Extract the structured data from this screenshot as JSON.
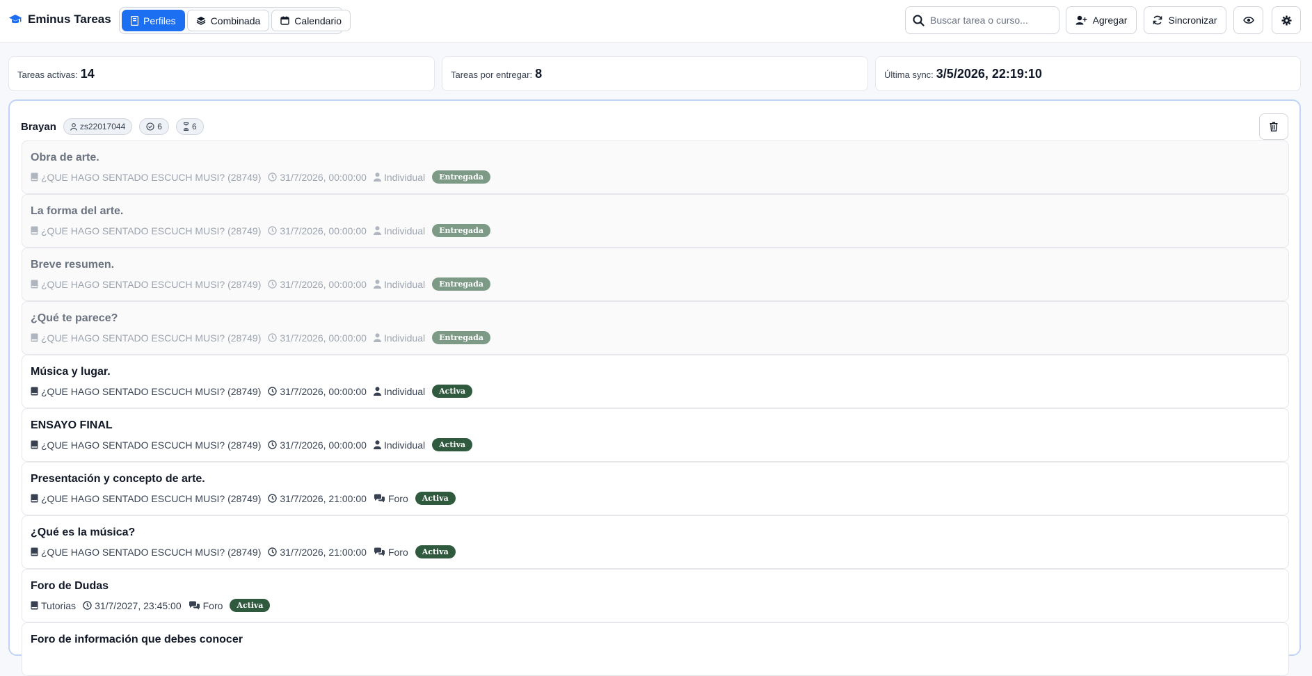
{
  "app": {
    "title": "Eminus Tareas",
    "brand_icon": "graduation-cap-icon"
  },
  "view_tabs": [
    {
      "label": "Perfiles",
      "icon": "profile-card-icon",
      "active": true
    },
    {
      "label": "Combinada",
      "icon": "layers-icon",
      "active": false
    },
    {
      "label": "Calendario",
      "icon": "calendar-icon",
      "active": false
    }
  ],
  "search": {
    "placeholder": "Buscar tarea o curso..."
  },
  "actions": {
    "add_label": "Agregar",
    "sync_label": "Sincronizar"
  },
  "stats": {
    "active_label": "Tareas activas:",
    "active_value": "14",
    "pending_label": "Tareas por entregar:",
    "pending_value": "8",
    "sync_label": "Última sync:",
    "sync_value": "3/5/2026, 22:19:10"
  },
  "profile": {
    "name": "Brayan",
    "user_id": "zs22017044",
    "done_count": "6",
    "pending_count": "6"
  },
  "tasks": [
    {
      "title": "Obra de arte.",
      "course": "¿QUE HAGO SENTADO ESCUCH MUSI? (28749)",
      "due": "31/7/2026, 00:00:00",
      "mode": "Individual",
      "status": "Entregada"
    },
    {
      "title": "La forma del arte.",
      "course": "¿QUE HAGO SENTADO ESCUCH MUSI? (28749)",
      "due": "31/7/2026, 00:00:00",
      "mode": "Individual",
      "status": "Entregada"
    },
    {
      "title": "Breve resumen.",
      "course": "¿QUE HAGO SENTADO ESCUCH MUSI? (28749)",
      "due": "31/7/2026, 00:00:00",
      "mode": "Individual",
      "status": "Entregada"
    },
    {
      "title": "¿Qué te parece?",
      "course": "¿QUE HAGO SENTADO ESCUCH MUSI? (28749)",
      "due": "31/7/2026, 00:00:00",
      "mode": "Individual",
      "status": "Entregada"
    },
    {
      "title": "Música y lugar.",
      "course": "¿QUE HAGO SENTADO ESCUCH MUSI? (28749)",
      "due": "31/7/2026, 00:00:00",
      "mode": "Individual",
      "status": "Activa"
    },
    {
      "title": "ENSAYO FINAL",
      "course": "¿QUE HAGO SENTADO ESCUCH MUSI? (28749)",
      "due": "31/7/2026, 00:00:00",
      "mode": "Individual",
      "status": "Activa"
    },
    {
      "title": "Presentación y concepto de arte.",
      "course": "¿QUE HAGO SENTADO ESCUCH MUSI? (28749)",
      "due": "31/7/2026, 21:00:00",
      "mode": "Foro",
      "status": "Activa"
    },
    {
      "title": "¿Qué es la música?",
      "course": "¿QUE HAGO SENTADO ESCUCH MUSI? (28749)",
      "due": "31/7/2026, 21:00:00",
      "mode": "Foro",
      "status": "Activa"
    },
    {
      "title": "Foro de Dudas",
      "course": "Tutorias",
      "due": "31/7/2027, 23:45:00",
      "mode": "Foro",
      "status": "Activa"
    },
    {
      "title": "Foro de información que debes conocer",
      "course": "",
      "due": "",
      "mode": "",
      "status": ""
    }
  ],
  "colors": {
    "accent": "#1d6ff2",
    "delivered": "#7c9a86",
    "active": "#2f5a3e"
  }
}
